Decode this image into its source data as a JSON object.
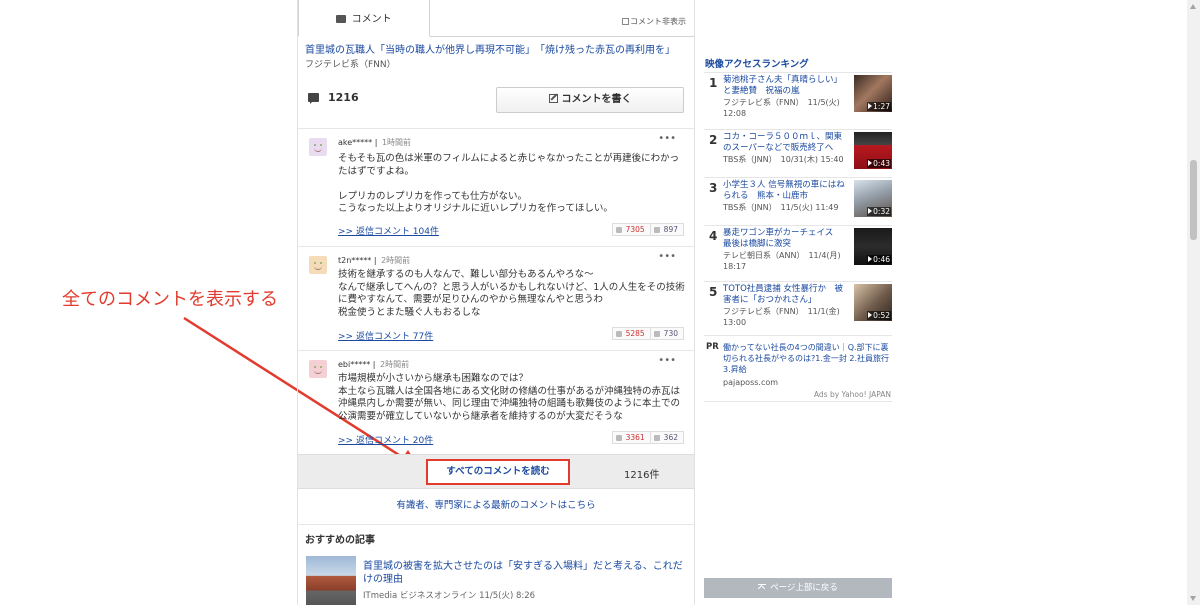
{
  "tabs": {
    "comment_tab": "コメント",
    "hide_toggle": "コメント非表示"
  },
  "article": {
    "related_link": "首里城の瓦職人「当時の職人が他界し再現不可能」　「焼け残った赤瓦の再利用を」",
    "source": "フジテレビ系（FNN）"
  },
  "comment_summary": {
    "count": "1216",
    "write_button": "コメントを書く"
  },
  "comments": [
    {
      "user": "ake*****",
      "time": "1時間前",
      "body": "そもそも瓦の色は米軍のフィルムによると赤じゃなかったことが再建後にわかっ\nたはずですよね。\n\nレプリカのレプリカを作っても仕方がない。\nこうなった以上よりオリジナルに近いレプリカを作ってほしい。",
      "reply": ">> 返信コメント 104件",
      "up": "7305",
      "down": "897"
    },
    {
      "user": "t2n*****",
      "time": "2時間前",
      "body": "技術を継承するのも人なんで、難しい部分もあるんやろな～\nなんで継承してへんの？と思う人がいるかもしれないけど、1人の人生をその技術\nに費やすなんて、需要が足りひんのやから無理なんやと思うわ\n税金使うとまた騒ぐ人もおるしな",
      "reply": ">> 返信コメント 77件",
      "up": "5285",
      "down": "730"
    },
    {
      "user": "ebi*****",
      "time": "2時間前",
      "body": "市場規模が小さいから継承も困難なのでは？\n本土なら瓦職人は全国各地にある文化財の修繕の仕事があるが沖縄独特の赤瓦は\n沖縄県内しか需要が無い、同じ理由で沖縄独特の組踊も歌舞伎のように本土での\n公演需要が確立していないから継承者を維持するのが大変だそうな",
      "reply": ">> 返信コメント 20件",
      "up": "3361",
      "down": "362"
    }
  ],
  "all_comments": {
    "button": "すべてのコメントを読む",
    "count": "1216件"
  },
  "expert_link": "有識者、専門家による最新のコメントはこちら",
  "recommend": {
    "title": "おすすめの記事",
    "item_link": "首里城の被害を拡大させたのは「安すぎる入場料」だと考える、これだけの理由",
    "item_source": "ITmedia ビジネスオンライン 11/5(火) 8:26"
  },
  "ranking": {
    "title": "映像アクセスランキング",
    "items": [
      {
        "no": "1",
        "title": "菊池桃子さん夫「真晴らしい」と妻絶賛　祝福の嵐",
        "meta": "フジテレビ系（FNN）　11/5(火)\n12:08",
        "duration": "1:27"
      },
      {
        "no": "2",
        "title": "コカ・コーラ５００ｍｌ、関東のスーパーなどで販売終了へ",
        "meta": "TBS系（JNN）　10/31(木) 15:40",
        "duration": "0:43"
      },
      {
        "no": "3",
        "title": "小学生３人 信号無視の車にはねられる　熊本・山鹿市",
        "meta": "TBS系（JNN）　11/5(火) 11:49",
        "duration": "0:32"
      },
      {
        "no": "4",
        "title": "暴走ワゴン車がカーチェイス　最後は橋脚に激突",
        "meta": "テレビ朝日系（ANN）　11/4(月)\n18:17",
        "duration": "0:46"
      },
      {
        "no": "5",
        "title": "TOTO社員逮捕 女性暴行か　被害者に「おつかれさん」",
        "meta": "フジテレビ系（FNN）　11/1(金)\n13:00",
        "duration": "0:52"
      }
    ]
  },
  "pr": {
    "tag": "PR",
    "link": "働かってない社長の4つの間違い｜Q.部下に裏切られる社長がやるのは?1.金一封 2.社員旅行 3.昇給",
    "domain": "pajaposs.com",
    "ads_by": "Ads by Yahoo! JAPAN"
  },
  "back_to_top": "ページ上部に戻る",
  "annotation": {
    "text": "全てのコメントを表示する",
    "color": "#e23b2e"
  },
  "colors": {
    "link": "#1b4aa0",
    "accent_red": "#e23b2e"
  }
}
